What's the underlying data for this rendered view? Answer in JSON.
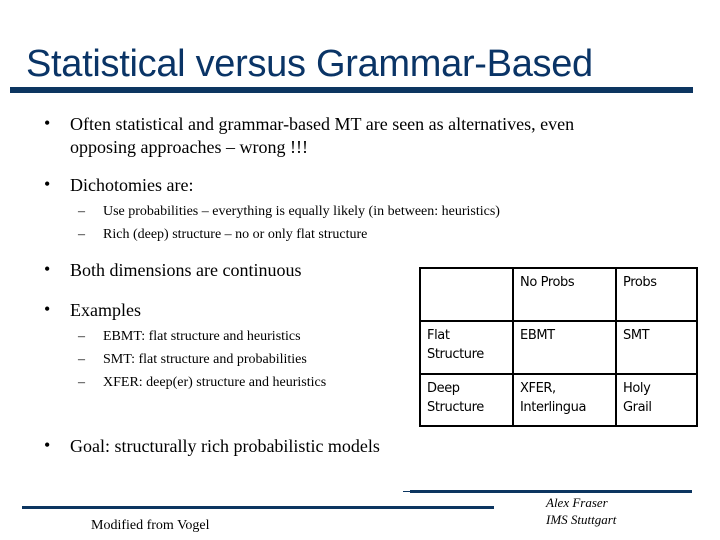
{
  "slide": {
    "title": "Statistical versus Grammar-Based",
    "bullets": [
      {
        "lines": [
          "Often statistical and grammar-based MT are seen as alternatives, even",
          "opposing approaches  – wrong !!!"
        ]
      },
      {
        "text": "Dichotomies are:",
        "subitems": [
          "Use probabilities – everything is equally likely (in between: heuristics)",
          "Rich (deep) structure –  no or only flat structure"
        ]
      },
      {
        "text": "Both dimensions are continuous"
      },
      {
        "text": "Examples",
        "subitems": [
          "EBMT: flat structure and heuristics",
          "SMT: flat structure and probabilities",
          "XFER: deep(er) structure and heuristics"
        ]
      },
      {
        "text": "Goal: structurally rich probabilistic models"
      }
    ],
    "bullet_glyph": "•",
    "dash_glyph": "–",
    "table": {
      "header": [
        "",
        "No Probs",
        "Probs"
      ],
      "rows": [
        {
          "label": [
            "Flat",
            "Structure"
          ],
          "no_probs": [
            "EBMT"
          ],
          "probs": [
            "SMT"
          ]
        },
        {
          "label": [
            "Deep",
            "Structure"
          ],
          "no_probs": [
            "XFER,",
            "Interlingua"
          ],
          "probs": [
            "Holy",
            "Grail"
          ]
        }
      ]
    },
    "footer": {
      "credit": "Modified from Vogel",
      "author": "Alex Fraser",
      "affiliation": "IMS Stuttgart"
    },
    "colors": {
      "title": "#0a3466",
      "rule": "#0c3560"
    }
  }
}
